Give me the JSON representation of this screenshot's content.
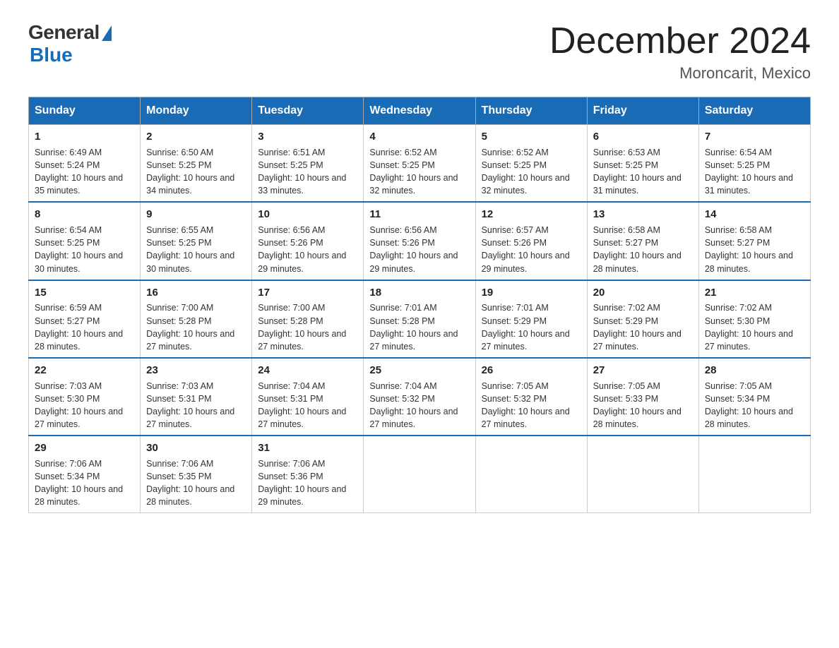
{
  "logo": {
    "general": "General",
    "blue": "Blue"
  },
  "title": {
    "month_year": "December 2024",
    "location": "Moroncarit, Mexico"
  },
  "days_of_week": [
    "Sunday",
    "Monday",
    "Tuesday",
    "Wednesday",
    "Thursday",
    "Friday",
    "Saturday"
  ],
  "weeks": [
    [
      {
        "day": "1",
        "sunrise": "6:49 AM",
        "sunset": "5:24 PM",
        "daylight": "10 hours and 35 minutes."
      },
      {
        "day": "2",
        "sunrise": "6:50 AM",
        "sunset": "5:25 PM",
        "daylight": "10 hours and 34 minutes."
      },
      {
        "day": "3",
        "sunrise": "6:51 AM",
        "sunset": "5:25 PM",
        "daylight": "10 hours and 33 minutes."
      },
      {
        "day": "4",
        "sunrise": "6:52 AM",
        "sunset": "5:25 PM",
        "daylight": "10 hours and 32 minutes."
      },
      {
        "day": "5",
        "sunrise": "6:52 AM",
        "sunset": "5:25 PM",
        "daylight": "10 hours and 32 minutes."
      },
      {
        "day": "6",
        "sunrise": "6:53 AM",
        "sunset": "5:25 PM",
        "daylight": "10 hours and 31 minutes."
      },
      {
        "day": "7",
        "sunrise": "6:54 AM",
        "sunset": "5:25 PM",
        "daylight": "10 hours and 31 minutes."
      }
    ],
    [
      {
        "day": "8",
        "sunrise": "6:54 AM",
        "sunset": "5:25 PM",
        "daylight": "10 hours and 30 minutes."
      },
      {
        "day": "9",
        "sunrise": "6:55 AM",
        "sunset": "5:25 PM",
        "daylight": "10 hours and 30 minutes."
      },
      {
        "day": "10",
        "sunrise": "6:56 AM",
        "sunset": "5:26 PM",
        "daylight": "10 hours and 29 minutes."
      },
      {
        "day": "11",
        "sunrise": "6:56 AM",
        "sunset": "5:26 PM",
        "daylight": "10 hours and 29 minutes."
      },
      {
        "day": "12",
        "sunrise": "6:57 AM",
        "sunset": "5:26 PM",
        "daylight": "10 hours and 29 minutes."
      },
      {
        "day": "13",
        "sunrise": "6:58 AM",
        "sunset": "5:27 PM",
        "daylight": "10 hours and 28 minutes."
      },
      {
        "day": "14",
        "sunrise": "6:58 AM",
        "sunset": "5:27 PM",
        "daylight": "10 hours and 28 minutes."
      }
    ],
    [
      {
        "day": "15",
        "sunrise": "6:59 AM",
        "sunset": "5:27 PM",
        "daylight": "10 hours and 28 minutes."
      },
      {
        "day": "16",
        "sunrise": "7:00 AM",
        "sunset": "5:28 PM",
        "daylight": "10 hours and 27 minutes."
      },
      {
        "day": "17",
        "sunrise": "7:00 AM",
        "sunset": "5:28 PM",
        "daylight": "10 hours and 27 minutes."
      },
      {
        "day": "18",
        "sunrise": "7:01 AM",
        "sunset": "5:28 PM",
        "daylight": "10 hours and 27 minutes."
      },
      {
        "day": "19",
        "sunrise": "7:01 AM",
        "sunset": "5:29 PM",
        "daylight": "10 hours and 27 minutes."
      },
      {
        "day": "20",
        "sunrise": "7:02 AM",
        "sunset": "5:29 PM",
        "daylight": "10 hours and 27 minutes."
      },
      {
        "day": "21",
        "sunrise": "7:02 AM",
        "sunset": "5:30 PM",
        "daylight": "10 hours and 27 minutes."
      }
    ],
    [
      {
        "day": "22",
        "sunrise": "7:03 AM",
        "sunset": "5:30 PM",
        "daylight": "10 hours and 27 minutes."
      },
      {
        "day": "23",
        "sunrise": "7:03 AM",
        "sunset": "5:31 PM",
        "daylight": "10 hours and 27 minutes."
      },
      {
        "day": "24",
        "sunrise": "7:04 AM",
        "sunset": "5:31 PM",
        "daylight": "10 hours and 27 minutes."
      },
      {
        "day": "25",
        "sunrise": "7:04 AM",
        "sunset": "5:32 PM",
        "daylight": "10 hours and 27 minutes."
      },
      {
        "day": "26",
        "sunrise": "7:05 AM",
        "sunset": "5:32 PM",
        "daylight": "10 hours and 27 minutes."
      },
      {
        "day": "27",
        "sunrise": "7:05 AM",
        "sunset": "5:33 PM",
        "daylight": "10 hours and 28 minutes."
      },
      {
        "day": "28",
        "sunrise": "7:05 AM",
        "sunset": "5:34 PM",
        "daylight": "10 hours and 28 minutes."
      }
    ],
    [
      {
        "day": "29",
        "sunrise": "7:06 AM",
        "sunset": "5:34 PM",
        "daylight": "10 hours and 28 minutes."
      },
      {
        "day": "30",
        "sunrise": "7:06 AM",
        "sunset": "5:35 PM",
        "daylight": "10 hours and 28 minutes."
      },
      {
        "day": "31",
        "sunrise": "7:06 AM",
        "sunset": "5:36 PM",
        "daylight": "10 hours and 29 minutes."
      },
      null,
      null,
      null,
      null
    ]
  ]
}
